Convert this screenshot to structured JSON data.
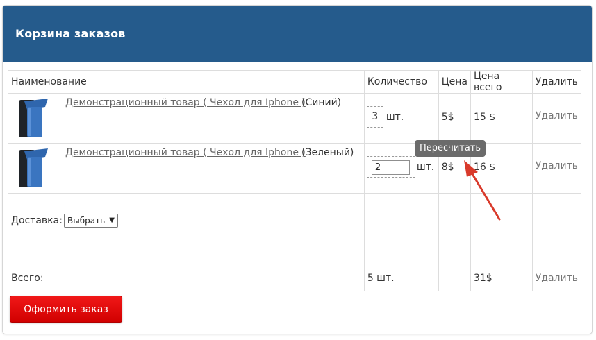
{
  "panel": {
    "title": "Корзина заказов"
  },
  "table": {
    "headers": {
      "name": "Наименование",
      "qty": "Количество",
      "price": "Цена",
      "total": "Цена всего",
      "delete": "Удалить"
    },
    "rows": [
      {
        "product": "Демонстрационный товар ( Чехол для Iphone )",
        "variant": "(Синий)",
        "qty": "3",
        "unit": "шт.",
        "price": "5$",
        "total": "15 $",
        "delete": "Удалить",
        "thumb_color": "#3a6fb5"
      },
      {
        "product": "Демонстрационный товар ( Чехол для Iphone )",
        "variant": "(Зеленый)",
        "qty": "2",
        "unit": "шт.",
        "price": "8$",
        "total": "16 $",
        "delete": "Удалить",
        "thumb_color": "#3a6fb5"
      }
    ],
    "footer": {
      "delivery_label": "Доставка:",
      "delivery_select": "Выбрать",
      "total_label": "Всего:",
      "total_qty": "5 шт.",
      "total_price": "31$",
      "delete": "Удалить"
    }
  },
  "tooltip": {
    "text": "Пересчитать"
  },
  "order_button": {
    "label": "Оформить заказ"
  },
  "colors": {
    "header_bg": "#255b8c",
    "button": "#e20000",
    "annotation_arrow": "#d93a2b"
  }
}
